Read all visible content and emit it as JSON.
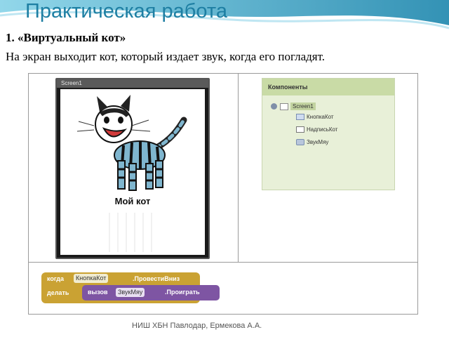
{
  "slide": {
    "title": "Практическая работа",
    "task_heading": "1. «Виртуальный кот»",
    "task_description": "На экран выходит кот, который издает звук, когда его погладят.",
    "footer": "НИШ ХБН Павлодар, Ермекова А.А."
  },
  "phone": {
    "screen_title": "Screen1",
    "button_label": "Мой кот"
  },
  "components": {
    "header": "Компоненты",
    "items": [
      {
        "label": "Screen1",
        "icon": "screen-icon"
      },
      {
        "label": "КнопкаКот",
        "icon": "button-icon"
      },
      {
        "label": "НадписьКот",
        "icon": "label-icon"
      },
      {
        "label": "ЗвукМяу",
        "icon": "sound-icon"
      }
    ]
  },
  "blocks": {
    "when": "когда",
    "component": "КнопкаКот",
    "event": ".ПровестиВниз",
    "do": "делать",
    "call": "вызов",
    "target": "ЗвукМяу",
    "method": ".Проиграть"
  },
  "colors": {
    "title": "#1e7fa3",
    "event_block": "#caa233",
    "call_block": "#7e55a3"
  }
}
